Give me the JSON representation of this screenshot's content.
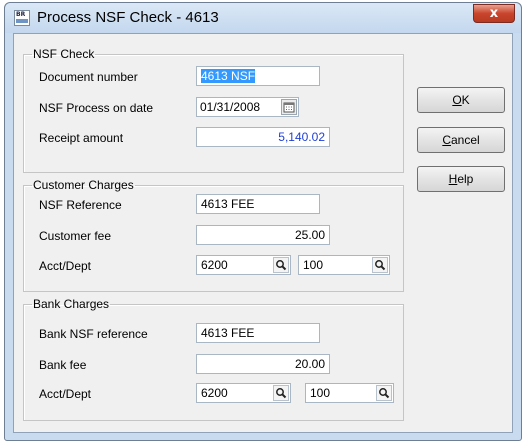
{
  "window": {
    "title": "Process NSF Check - 4613",
    "app_icon_text": "BR",
    "close_glyph": "x"
  },
  "nsf_check": {
    "legend": "NSF Check",
    "document_number_label": "Document number",
    "document_number": "4613 NSF",
    "process_date_label": "NSF Process on date",
    "process_date": "01/31/2008",
    "receipt_amount_label": "Receipt amount",
    "receipt_amount": "5,140.02"
  },
  "customer_charges": {
    "legend": "Customer Charges",
    "nsf_reference_label": "NSF Reference",
    "nsf_reference": "4613 FEE",
    "customer_fee_label": "Customer fee",
    "customer_fee": "25.00",
    "acct_dept_label": "Acct/Dept",
    "acct": "6200",
    "dept": "100"
  },
  "bank_charges": {
    "legend": "Bank Charges",
    "bank_nsf_reference_label": "Bank NSF reference",
    "bank_nsf_reference": "4613 FEE",
    "bank_fee_label": "Bank fee",
    "bank_fee": "20.00",
    "acct_dept_label": "Acct/Dept",
    "acct": "6200",
    "dept": "100"
  },
  "buttons": {
    "ok_mnemonic": "O",
    "ok_rest": "K",
    "cancel_mnemonic": "C",
    "cancel_rest": "ancel",
    "help_mnemonic": "H",
    "help_rest": "elp"
  },
  "colors": {
    "selection": "#3399ff",
    "amount_text": "#1f3fd6",
    "close_button": "#c9442c"
  },
  "icons": {
    "lookup": "magnifier-icon",
    "calendar": "calendar-icon"
  }
}
